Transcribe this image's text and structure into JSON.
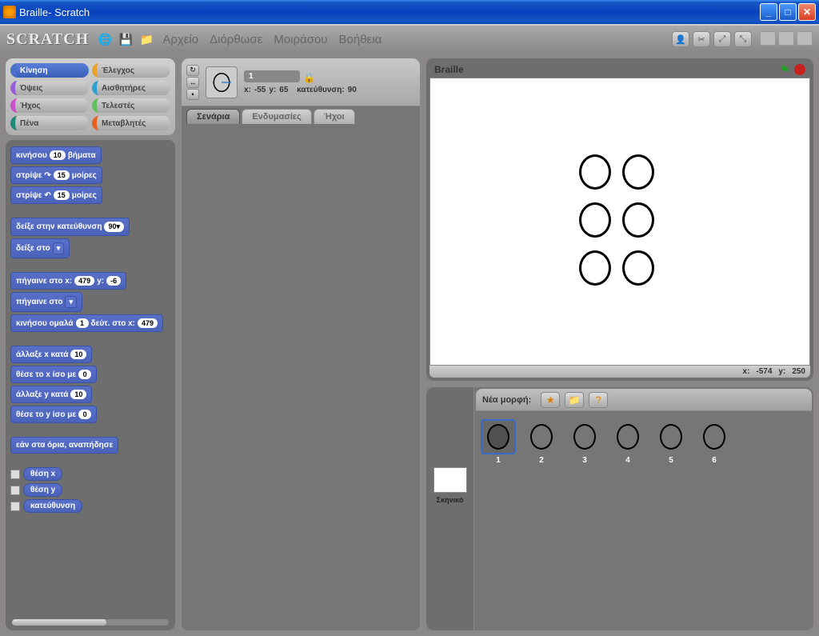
{
  "window": {
    "title": "Braille- Scratch"
  },
  "toolbar": {
    "logo": "SCRATCH",
    "menus": [
      "Αρχείο",
      "Διόρθωσε",
      "Μοιράσου",
      "Βοήθεια"
    ]
  },
  "categories": [
    {
      "label": "Κίνηση",
      "cls": "cat-motion"
    },
    {
      "label": "Έλεγχος",
      "cls": "cat-control"
    },
    {
      "label": "Όψεις",
      "cls": "cat-looks"
    },
    {
      "label": "Αισθητήρες",
      "cls": "cat-sensing"
    },
    {
      "label": "Ήχος",
      "cls": "cat-sound"
    },
    {
      "label": "Τελεστές",
      "cls": "cat-ops"
    },
    {
      "label": "Πένα",
      "cls": "cat-pen"
    },
    {
      "label": "Μεταβλητές",
      "cls": "cat-vars"
    }
  ],
  "blocks": {
    "move_steps": {
      "pre": "κινήσου",
      "val": "10",
      "post": "βήματα"
    },
    "turn_cw": {
      "pre": "στρίψε ↷",
      "val": "15",
      "post": "μοίρες"
    },
    "turn_ccw": {
      "pre": "στρίψε ↶",
      "val": "15",
      "post": "μοίρες"
    },
    "point_dir": {
      "pre": "δείξε στην κατεύθυνση",
      "val": "90▾"
    },
    "point_to": {
      "pre": "δείξε στο",
      "val": "▾"
    },
    "goto_xy": {
      "pre": "πήγαινε στο x:",
      "x": "479",
      "mid": "y:",
      "y": "-6"
    },
    "goto": {
      "pre": "πήγαινε στο",
      "val": "▾"
    },
    "glide": {
      "pre": "κινήσου ομαλά",
      "s": "1",
      "mid": "δεύτ. στο x:",
      "x": "479"
    },
    "change_x": {
      "pre": "άλλαξε x κατά",
      "val": "10"
    },
    "set_x": {
      "pre": "θέσε το x ίσο με",
      "val": "0"
    },
    "change_y": {
      "pre": "άλλαξε y κατά",
      "val": "10"
    },
    "set_y": {
      "pre": "θέσε το y ίσο με",
      "val": "0"
    },
    "bounce": "εάν στα όρια, αναπήδησε",
    "rep_x": "θέση x",
    "rep_y": "θέση y",
    "rep_dir": "κατεύθυνση"
  },
  "sprite_header": {
    "name": "1",
    "xlabel": "x:",
    "x": "-55",
    "ylabel": "y:",
    "y": "65",
    "dirlabel": "κατεύθυνση:",
    "dir": "90"
  },
  "tabs": [
    "Σενάρια",
    "Ενδυμασίες",
    "Ήχοι"
  ],
  "stage": {
    "title": "Braille",
    "mouse_x_label": "x:",
    "mouse_x": "-574",
    "mouse_y_label": "y:",
    "mouse_y": "250"
  },
  "sprites_panel": {
    "new_label": "Νέα μορφή:",
    "stage_label": "Σκηνικό",
    "items": [
      "1",
      "2",
      "3",
      "4",
      "5",
      "6"
    ]
  }
}
